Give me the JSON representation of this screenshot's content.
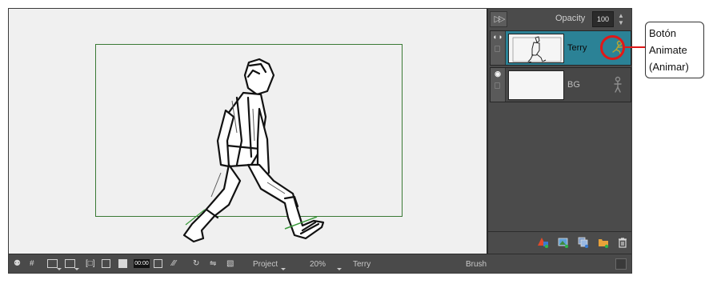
{
  "colors": {
    "stage_background": "#f0f0f0",
    "camera_frame": "#3a7a35",
    "panel_background": "#4b4b4b",
    "selected_layer": "#2b8296",
    "callout_red": "#e01818"
  },
  "layer_panel": {
    "opacity_label": "Opacity",
    "opacity_value": "100",
    "layers": [
      {
        "name": "Terry",
        "selected": true,
        "animate_icon": "animate-icon"
      },
      {
        "name": "BG",
        "selected": false,
        "animate_icon": "animate-icon"
      }
    ],
    "footer_icons": [
      "add-vector-layer-icon",
      "add-bitmap-layer-icon",
      "duplicate-layer-icon",
      "add-group-icon",
      "delete-layer-icon"
    ]
  },
  "status_bar": {
    "timecode": "00:00",
    "view_mode": "Project",
    "zoom": "20%",
    "current_layer": "Terry",
    "current_tool": "Brush"
  },
  "callout": {
    "line1": "Botón",
    "line2": "Animate",
    "line3": "(Animar)"
  }
}
